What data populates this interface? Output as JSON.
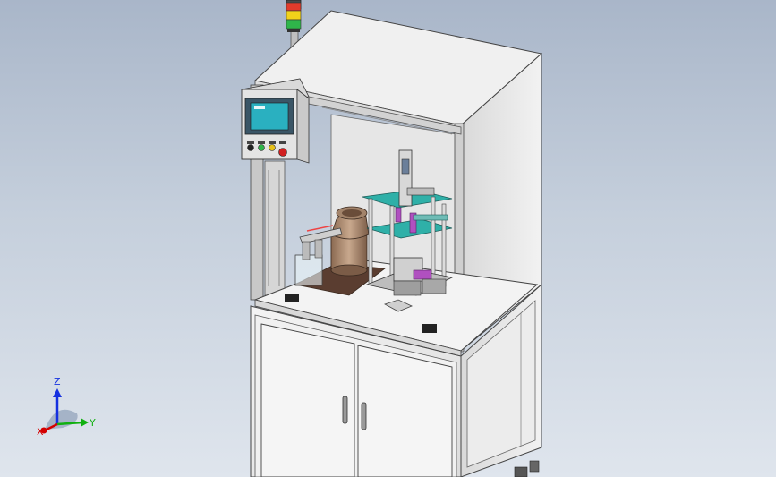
{
  "viewport": {
    "background_top": "#a9b6c9",
    "background_bottom": "#dfe5ed"
  },
  "triad": {
    "x_label": "X",
    "y_label": "Y",
    "z_label": "Z",
    "x_color": "#d40000",
    "y_color": "#10b010",
    "z_color": "#1530e0"
  },
  "tower_light": {
    "segments": [
      "red",
      "yellow",
      "green"
    ],
    "colors": [
      "#e23b2b",
      "#f2d21a",
      "#2fb54a"
    ]
  },
  "hmi": {
    "screen_color": "#2ab0c0",
    "buttons": [
      "#222222",
      "#2fb54a",
      "#e8c21a",
      "#d02020"
    ]
  },
  "machine": {
    "frame_color": "#eeeeee",
    "plate_color": "#5a3d30",
    "fixture_color": "#2fb0a8",
    "accent_color": "#b050c0"
  }
}
